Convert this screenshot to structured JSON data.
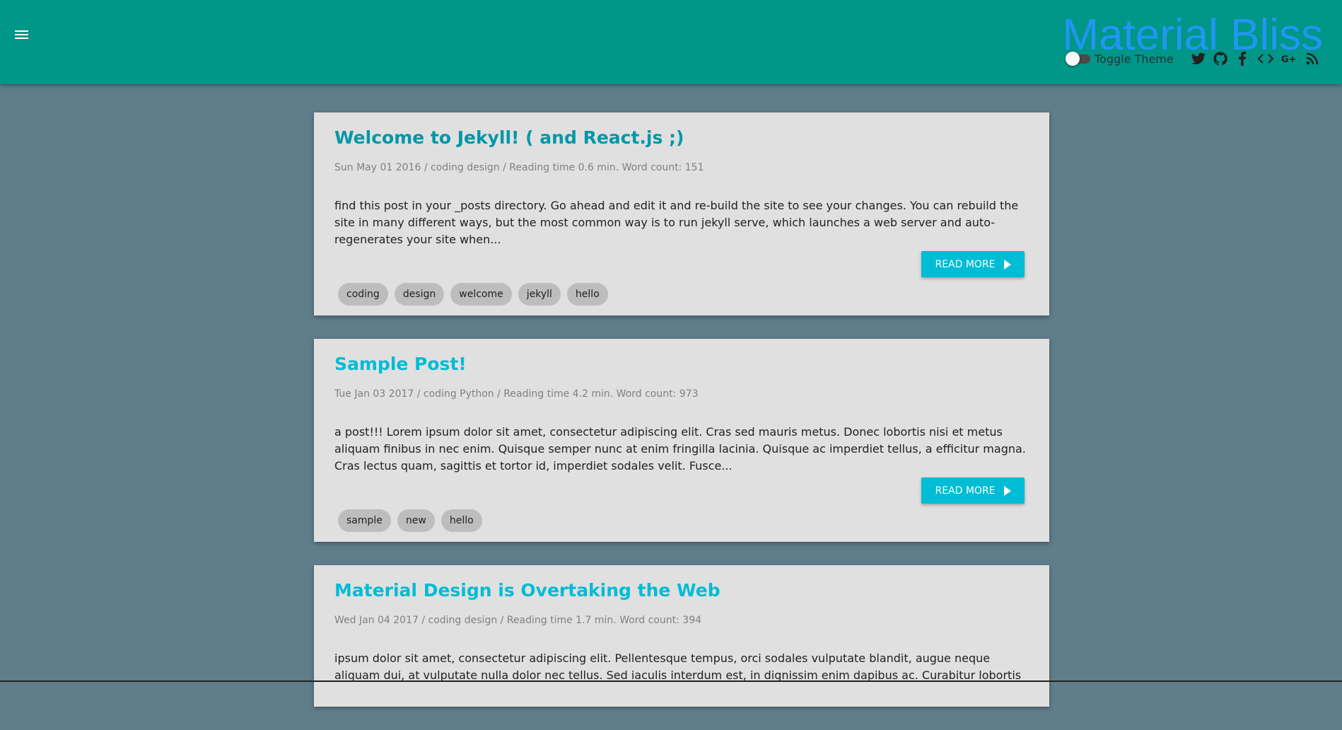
{
  "header": {
    "site_title": "Material Bliss",
    "toggle_theme_label": "Toggle Theme",
    "bg_color": "#009688",
    "title_color": "#2196f3",
    "social_icons": [
      "twitter-icon",
      "github-icon",
      "facebook-icon",
      "code-icon",
      "google-plus-icon",
      "rss-icon"
    ]
  },
  "posts": [
    {
      "title": "Welcome to Jekyll! ( and React.js ;)",
      "meta": "Sun May 01 2016 / coding design / Reading time 0.6 min. Word count: 151",
      "excerpt": "find this post in your _posts directory. Go ahead and edit it and re-build the site to see your changes. You can rebuild the site in many different ways, but the most common way is to run jekyll serve, which launches a web server and auto-regenerates your site when...",
      "read_more": "READ MORE",
      "tags": [
        "coding",
        "design",
        "welcome",
        "jekyll",
        "hello"
      ]
    },
    {
      "title": "Sample Post!",
      "meta": "Tue Jan 03 2017 / coding Python / Reading time 4.2 min. Word count: 973",
      "excerpt": "a post!!! Lorem ipsum dolor sit amet, consectetur adipiscing elit. Cras sed mauris metus. Donec lobortis nisi et metus aliquam finibus in nec enim. Quisque semper nunc at enim fringilla lacinia. Quisque ac imperdiet tellus, a efficitur magna. Cras lectus quam, sagittis et tortor id, imperdiet sodales velit. Fusce...",
      "read_more": "READ MORE",
      "tags": [
        "sample",
        "new",
        "hello"
      ]
    },
    {
      "title": "Material Design is Overtaking the Web",
      "meta": "Wed Jan 04 2017 / coding design / Reading time 1.7 min. Word count: 394",
      "excerpt": "ipsum dolor sit amet, consectetur adipiscing elit. Pellentesque tempus, orci sodales vulputate blandit, augue neque aliquam dui, at vulputate nulla dolor nec tellus. Sed iaculis interdum est, in dignissim enim dapibus ac. Curabitur lobortis"
    }
  ]
}
